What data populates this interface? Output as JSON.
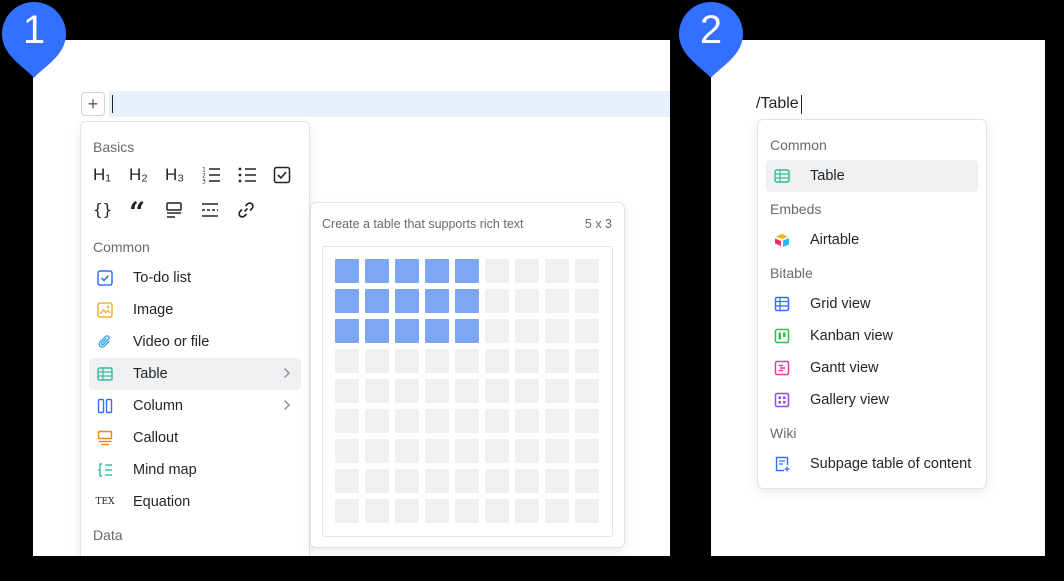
{
  "badges": [
    "1",
    "2"
  ],
  "editor": {
    "add_button": "+",
    "menu": {
      "basics_heading": "Basics",
      "basics_icons_row1": [
        "H₁",
        "H₂",
        "H₃"
      ],
      "common_heading": "Common",
      "items": [
        {
          "label": "To-do list",
          "icon": "checkbox-icon"
        },
        {
          "label": "Image",
          "icon": "image-icon"
        },
        {
          "label": "Video or file",
          "icon": "paperclip-icon"
        },
        {
          "label": "Table",
          "icon": "table-icon"
        },
        {
          "label": "Column",
          "icon": "column-icon"
        },
        {
          "label": "Callout",
          "icon": "callout-icon"
        },
        {
          "label": "Mind map",
          "icon": "mindmap-icon"
        },
        {
          "label": "Equation",
          "icon": "tex-icon"
        }
      ],
      "tex_text": "TEX",
      "data_heading": "Data"
    },
    "table_popup": {
      "description": "Create a table that supports rich text",
      "size_label": "5 x 3",
      "grid_rows": 9,
      "grid_cols": 9,
      "selected_rows": 3,
      "selected_cols": 5
    }
  },
  "search": {
    "query": "/Table",
    "sections": [
      {
        "heading": "Common",
        "items": [
          {
            "label": "Table",
            "icon": "table-icon",
            "color": "#2fbd9a"
          }
        ]
      },
      {
        "heading": "Embeds",
        "items": [
          {
            "label": "Airtable",
            "icon": "airtable-icon"
          }
        ]
      },
      {
        "heading": "Bitable",
        "items": [
          {
            "label": "Grid view",
            "icon": "grid-view-icon",
            "color": "#3370ff"
          },
          {
            "label": "Kanban view",
            "icon": "kanban-view-icon",
            "color": "#35bd4b"
          },
          {
            "label": "Gantt view",
            "icon": "gantt-view-icon",
            "color": "#e6399a"
          },
          {
            "label": "Gallery view",
            "icon": "gallery-view-icon",
            "color": "#8a4fe0"
          }
        ]
      },
      {
        "heading": "Wiki",
        "items": [
          {
            "label": "Subpage table of content",
            "icon": "subpage-toc-icon",
            "color": "#3370ff"
          }
        ]
      }
    ]
  },
  "colors": {
    "accent": "#3370ff",
    "highlight": "#e8f0fd",
    "selected_cell": "#7ea6f2",
    "empty_cell": "#eff0f1"
  }
}
